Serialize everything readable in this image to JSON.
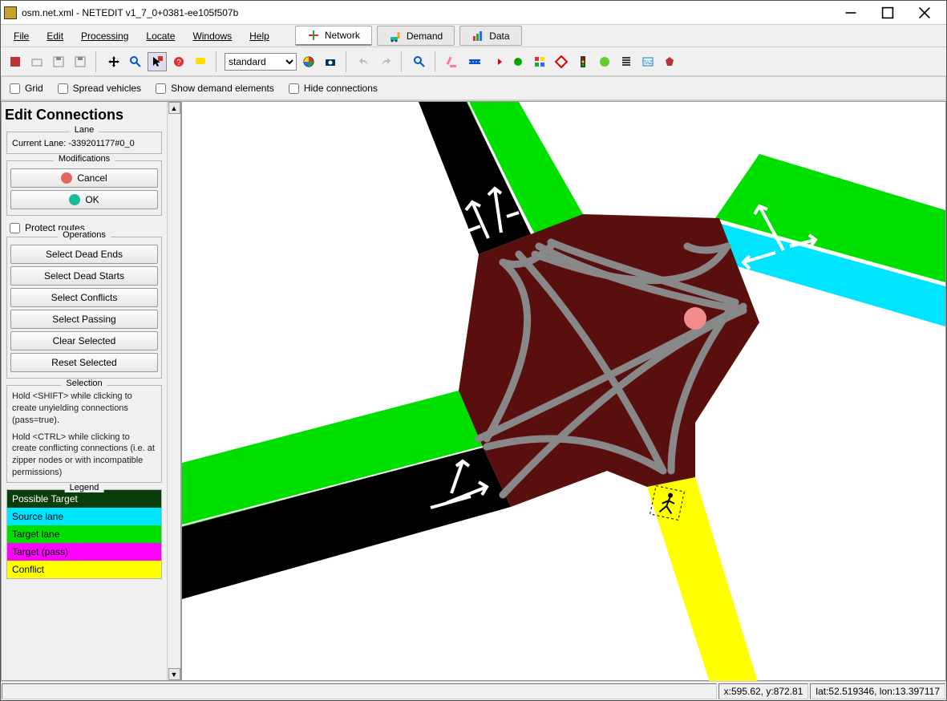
{
  "window": {
    "title": "osm.net.xml - NETEDIT v1_7_0+0381-ee105f507b"
  },
  "menu": {
    "file": "File",
    "edit": "Edit",
    "processing": "Processing",
    "locate": "Locate",
    "windows": "Windows",
    "help": "Help"
  },
  "supermodes": {
    "network": "Network",
    "demand": "Demand",
    "data": "Data"
  },
  "toolbar": {
    "coloring_select": "standard"
  },
  "options": {
    "grid": "Grid",
    "spread": "Spread vehicles",
    "showdemand": "Show demand elements",
    "hideconn": "Hide connections"
  },
  "panel": {
    "title": "Edit Connections",
    "lane_legend": "Lane",
    "current_lane_label": "Current Lane: -339201177#0_0",
    "mod_legend": "Modifications",
    "cancel": "Cancel",
    "ok": "OK",
    "protect_routes": "Protect routes",
    "ops_legend": "Operations",
    "ops": {
      "dead_ends": "Select Dead Ends",
      "dead_starts": "Select Dead Starts",
      "conflicts": "Select Conflicts",
      "passing": "Select Passing",
      "clear": "Clear Selected",
      "reset": "Reset Selected"
    },
    "sel_legend": "Selection",
    "help_shift": "Hold <SHIFT> while clicking to create unyielding connections (pass=true).",
    "help_ctrl": "Hold <CTRL> while clicking to create conflicting connections (i.e. at zipper nodes or with incompatible permissions)",
    "leg_legend": "Legend",
    "legend": {
      "possible": "Possible Target",
      "source": "Source lane",
      "target": "Target lane",
      "target_pass": "Target (pass)",
      "conflict": "Conflict"
    }
  },
  "status": {
    "xy": "x:595.62, y:872.81",
    "latlon": "lat:52.519346, lon:13.397117"
  },
  "colors": {
    "possible": "#0b3d0b",
    "source": "#00e5ff",
    "target": "#00e000",
    "target_pass": "#ff00ff",
    "conflict": "#ffff00",
    "junction": "#5a0f0f",
    "road_black": "#000000",
    "conn_gray": "#888888"
  }
}
